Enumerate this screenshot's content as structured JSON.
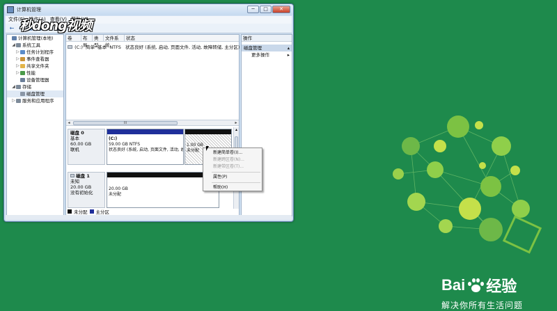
{
  "window": {
    "title": "计算机管理",
    "minimize": "─",
    "maximize": "□",
    "close": "✕"
  },
  "watermark": "秒dong视频",
  "menubar": [
    "文件(F)",
    "操作(A)",
    "查看(V)",
    "帮助(H)"
  ],
  "toolbar": [
    "←",
    "→",
    "▣",
    "▤",
    "?",
    "▦"
  ],
  "tree": [
    {
      "indent": 0,
      "exp": "",
      "label": "计算机管理(本地)",
      "color": "#5f7fa9"
    },
    {
      "indent": 1,
      "exp": "◢",
      "label": "系统工具",
      "color": "#7d8a99"
    },
    {
      "indent": 2,
      "exp": "▷",
      "label": "任务计划程序",
      "color": "#5b8cc9"
    },
    {
      "indent": 2,
      "exp": "▷",
      "label": "事件查看器",
      "color": "#c9943a"
    },
    {
      "indent": 2,
      "exp": "▷",
      "label": "共享文件夹",
      "color": "#e3b54a"
    },
    {
      "indent": 2,
      "exp": "▷",
      "label": "性能",
      "color": "#4a9a4a"
    },
    {
      "indent": 2,
      "exp": "",
      "label": "设备管理器",
      "color": "#6b7f99"
    },
    {
      "indent": 1,
      "exp": "◢",
      "label": "存储",
      "color": "#7d8a99"
    },
    {
      "indent": 2,
      "exp": "",
      "label": "磁盘管理",
      "color": "#8a96a6",
      "selected": true
    },
    {
      "indent": 1,
      "exp": "▷",
      "label": "服务和应用程序",
      "color": "#7d8a99"
    }
  ],
  "volume_list": {
    "headers": [
      "卷",
      "布局",
      "类型",
      "文件系统",
      "状态"
    ],
    "row": [
      "(C:)",
      "简单",
      "基本",
      "NTFS",
      "状态良好 (系统, 启动, 页面文件, 活动, 故障转储, 主分区)"
    ],
    "scroll_mid": "III"
  },
  "disks": [
    {
      "name": "磁盘 0",
      "type": "基本",
      "size": "60.00 GB",
      "status": "联机",
      "partitions": [
        {
          "title": "(C:)",
          "size": "59.00 GB NTFS",
          "status": "状态良好 (系统, 启动, 页面文件, 活动, 故障转储, 主分区)",
          "bar": "#1f2f9a"
        },
        {
          "title": "",
          "size": "1.00 GB",
          "status": "未分配",
          "bar": "#111111"
        }
      ]
    },
    {
      "name": "磁盘 1",
      "type": "未知",
      "size": "20.00 GB",
      "status": "没有初始化",
      "partitions": [
        {
          "title": "",
          "size": "20.00 GB",
          "status": "未分配",
          "bar": "#111111"
        }
      ]
    }
  ],
  "legend": [
    {
      "label": "未分配",
      "color": "#111111"
    },
    {
      "label": "主分区",
      "color": "#1f2f9a"
    }
  ],
  "actions": {
    "header": "操作",
    "selected": "磁盘管理",
    "items": [
      "更多操作"
    ]
  },
  "context_menu": [
    {
      "label": "新建简单卷(I)...",
      "disabled": false
    },
    {
      "label": "新建跨区卷(N)...",
      "disabled": true
    },
    {
      "label": "新建带区卷(T)...",
      "disabled": true
    },
    {
      "sep": true
    },
    {
      "label": "属性(P)",
      "disabled": false
    },
    {
      "sep": true
    },
    {
      "label": "帮助(H)",
      "disabled": false
    }
  ],
  "brand": {
    "name_left": "Bai",
    "name_right": "经验",
    "slogan": "解决你所有生活问题"
  }
}
